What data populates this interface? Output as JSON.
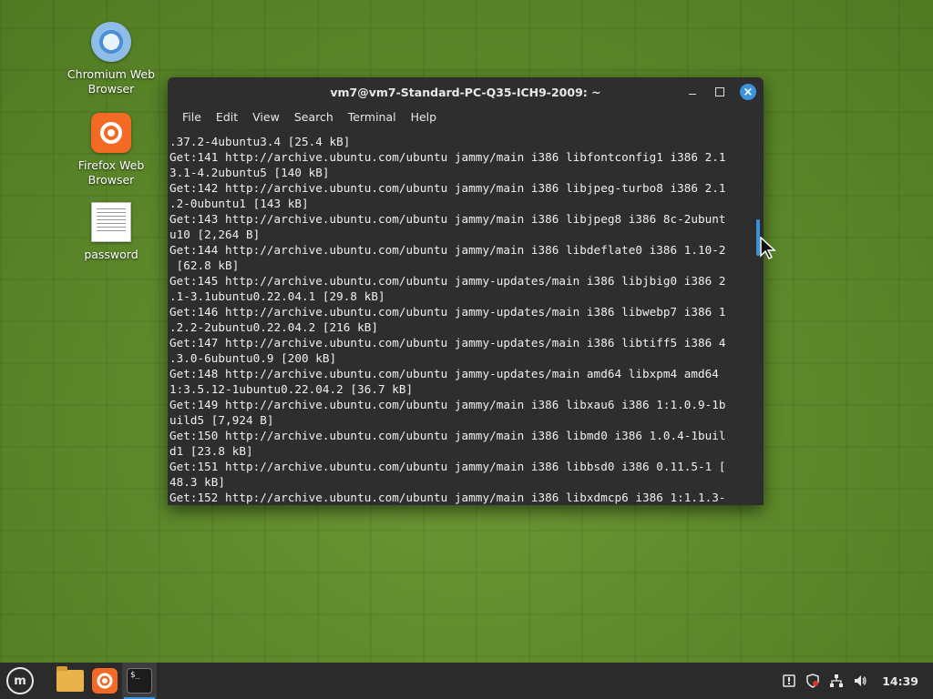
{
  "desktop": {
    "icons": [
      {
        "label": "Chromium Web\nBrowser",
        "icon": "chromium-icon"
      },
      {
        "label": "Firefox Web\nBrowser",
        "icon": "firefox-icon"
      },
      {
        "label": "password",
        "icon": "document-icon"
      }
    ]
  },
  "terminal": {
    "title": "vm7@vm7-Standard-PC-Q35-ICH9-2009: ~",
    "menu": [
      "File",
      "Edit",
      "View",
      "Search",
      "Terminal",
      "Help"
    ],
    "lines": [
      ".37.2-4ubuntu3.4 [25.4 kB]",
      "Get:141 http://archive.ubuntu.com/ubuntu jammy/main i386 libfontconfig1 i386 2.1",
      "3.1-4.2ubuntu5 [140 kB]",
      "Get:142 http://archive.ubuntu.com/ubuntu jammy/main i386 libjpeg-turbo8 i386 2.1",
      ".2-0ubuntu1 [143 kB]",
      "Get:143 http://archive.ubuntu.com/ubuntu jammy/main i386 libjpeg8 i386 8c-2ubunt",
      "u10 [2,264 B]",
      "Get:144 http://archive.ubuntu.com/ubuntu jammy/main i386 libdeflate0 i386 1.10-2",
      " [62.8 kB]",
      "Get:145 http://archive.ubuntu.com/ubuntu jammy-updates/main i386 libjbig0 i386 2",
      ".1-3.1ubuntu0.22.04.1 [29.8 kB]",
      "Get:146 http://archive.ubuntu.com/ubuntu jammy-updates/main i386 libwebp7 i386 1",
      ".2.2-2ubuntu0.22.04.2 [216 kB]",
      "Get:147 http://archive.ubuntu.com/ubuntu jammy-updates/main i386 libtiff5 i386 4",
      ".3.0-6ubuntu0.9 [200 kB]",
      "Get:148 http://archive.ubuntu.com/ubuntu jammy-updates/main amd64 libxpm4 amd64",
      "1:3.5.12-1ubuntu0.22.04.2 [36.7 kB]",
      "Get:149 http://archive.ubuntu.com/ubuntu jammy/main i386 libxau6 i386 1:1.0.9-1b",
      "uild5 [7,924 B]",
      "Get:150 http://archive.ubuntu.com/ubuntu jammy/main i386 libmd0 i386 1.0.4-1buil",
      "d1 [23.8 kB]",
      "Get:151 http://archive.ubuntu.com/ubuntu jammy/main i386 libbsd0 i386 0.11.5-1 [",
      "48.3 kB]",
      "Get:152 http://archive.ubuntu.com/ubuntu jammy/main i386 libxdmcp6 i386 1:1.1.3-"
    ]
  },
  "taskbar": {
    "menu_logo": "m",
    "terminal_glyph": "$_",
    "clock": "14:39"
  }
}
